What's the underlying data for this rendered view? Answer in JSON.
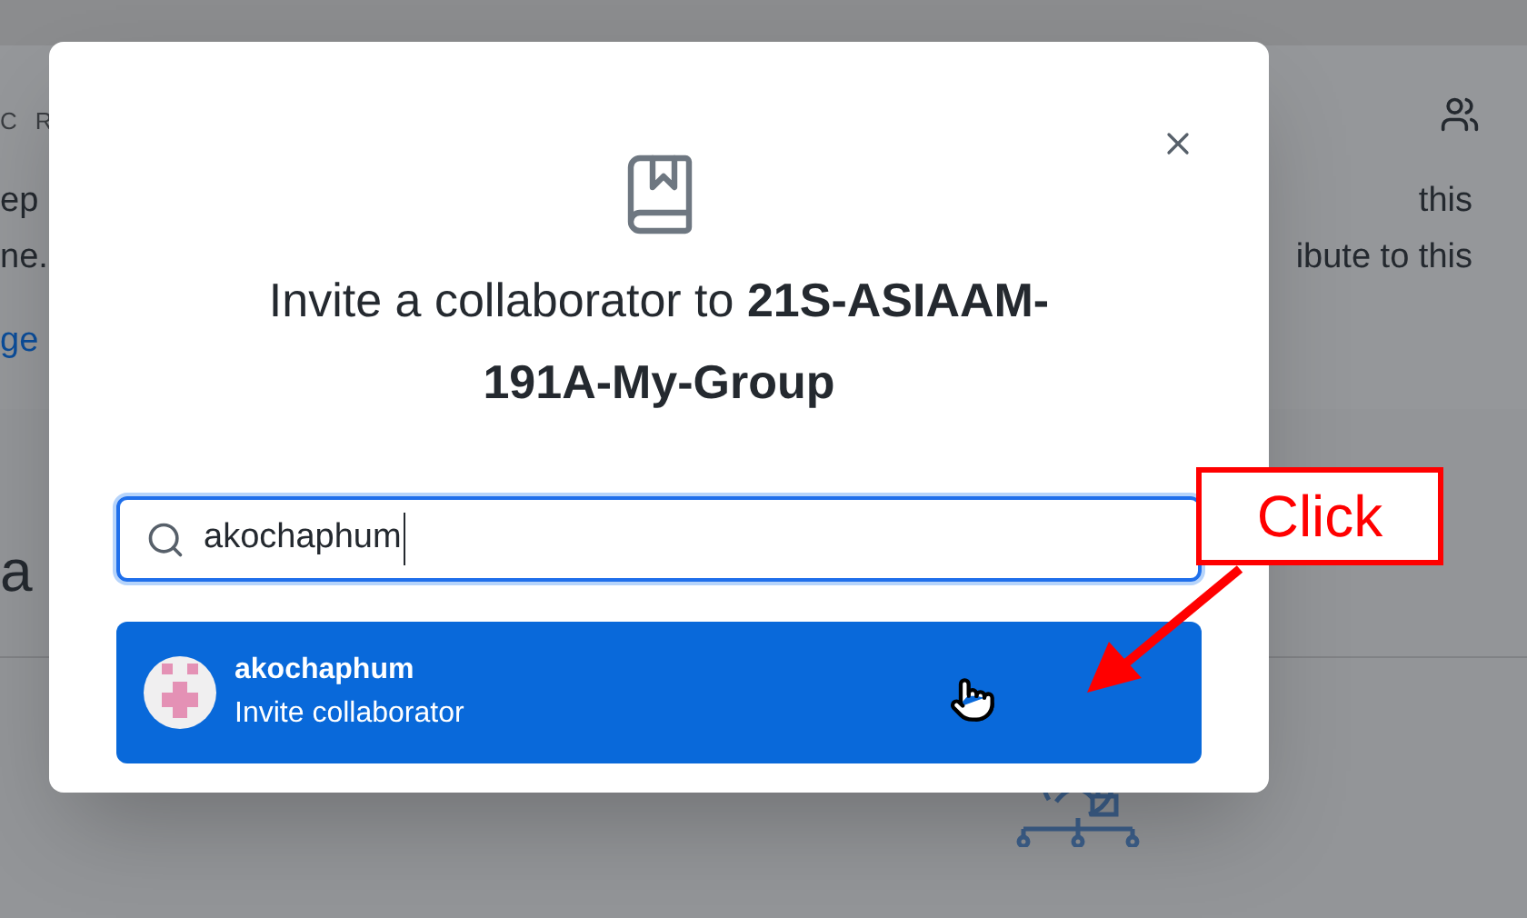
{
  "background": {
    "header_fragments": [
      "C",
      "R"
    ],
    "text_left": [
      "ep",
      "ne."
    ],
    "link_left": "ge",
    "heading_left": "a",
    "text_right": [
      "this",
      "ibute to this"
    ]
  },
  "dialog": {
    "title": "Invite a collaborator to **21S-ASIAAM-191A-My-Group**",
    "search": {
      "value": "akochaphum"
    },
    "results": [
      {
        "name": "akochaphum",
        "action": "Invite collaborator",
        "selected": true
      }
    ]
  },
  "annotation": {
    "label": "Click"
  }
}
